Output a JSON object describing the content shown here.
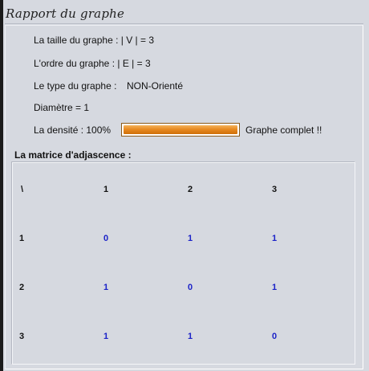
{
  "window": {
    "title": "Rapport du graphe"
  },
  "info": {
    "size_line": "La taille du graphe : | V | = 3",
    "order_line": "L'ordre du graphe : | E | = 3",
    "type_label": "Le type du graphe :",
    "type_value": "NON-Orienté",
    "diameter_line": "Diamètre = 1",
    "density_label": "La densité : 100%",
    "density_fraction": 1.0,
    "complete_label": "Graphe complet !!"
  },
  "matrix": {
    "heading": "La matrice d'adjascence :",
    "corner": "\\",
    "col_headers": [
      "1",
      "2",
      "3"
    ],
    "rows": [
      {
        "label": "1",
        "values": [
          "0",
          "1",
          "1"
        ]
      },
      {
        "label": "2",
        "values": [
          "1",
          "0",
          "1"
        ]
      },
      {
        "label": "3",
        "values": [
          "1",
          "1",
          "0"
        ]
      }
    ]
  },
  "colors": {
    "matrix_value": "#1b22c8",
    "progress": "#e88a20"
  }
}
